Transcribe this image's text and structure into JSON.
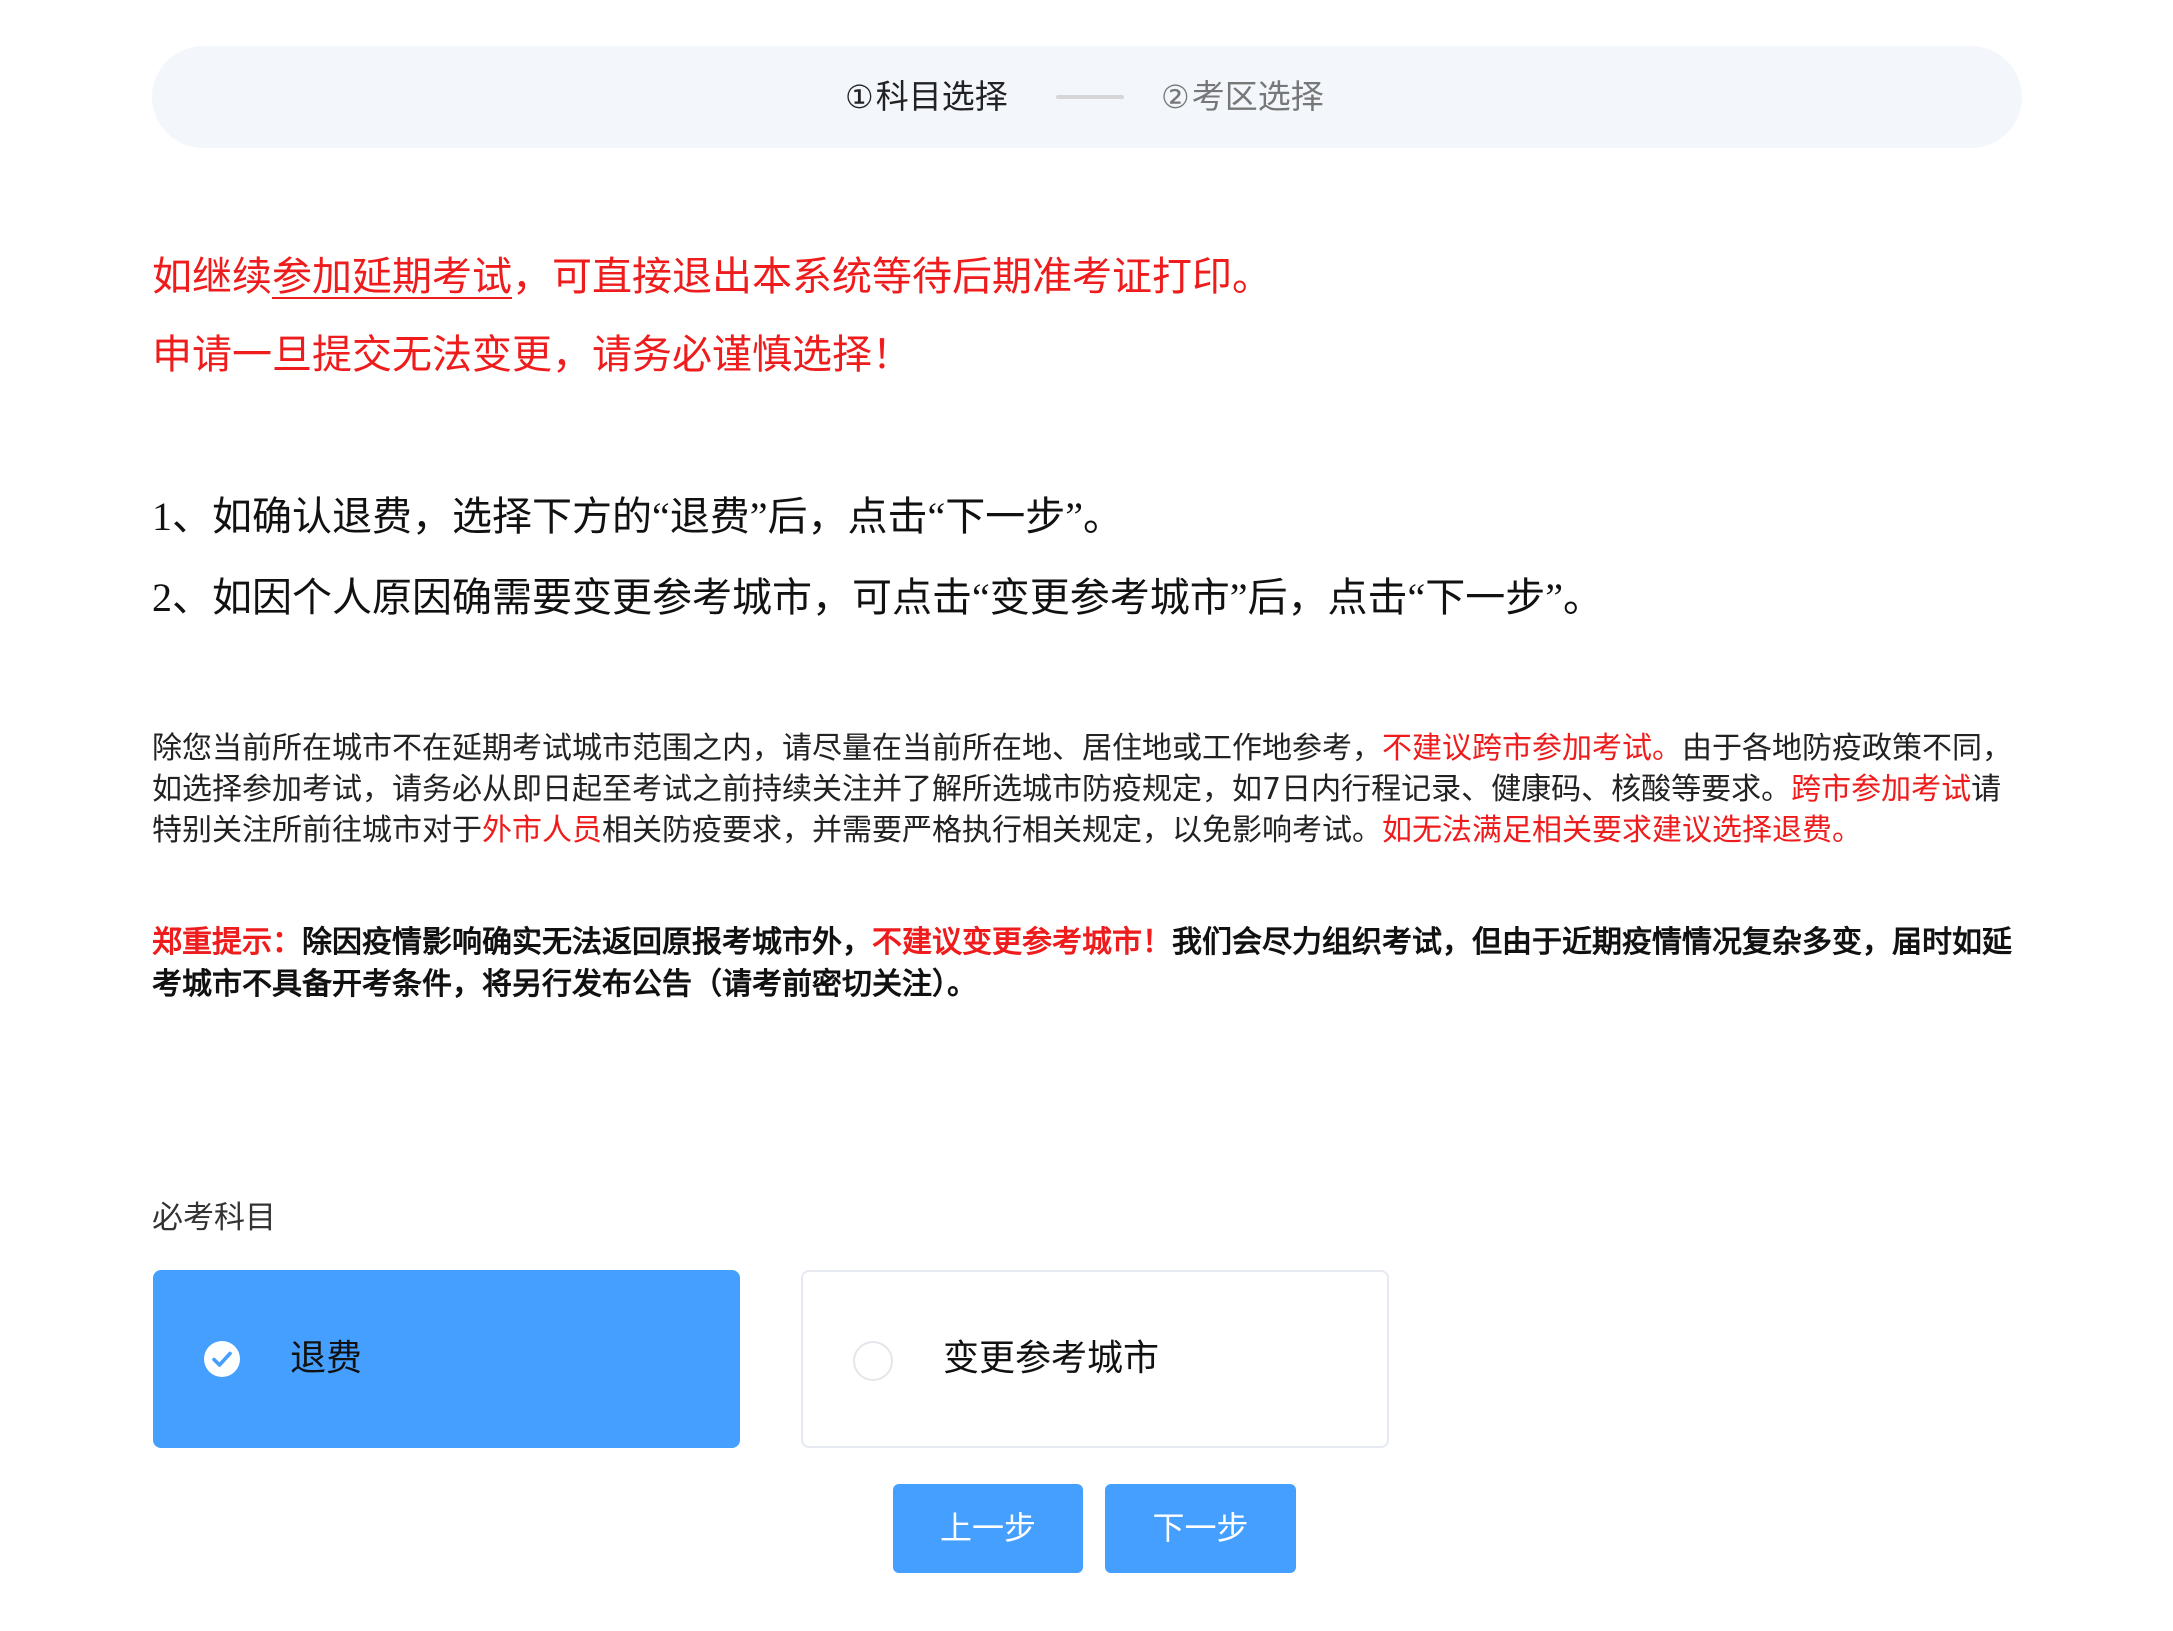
{
  "stepper": {
    "step1_number": "①",
    "step1_label": "科目选择",
    "step2_number": "②",
    "step2_label": "考区选择"
  },
  "notices": {
    "line1_prefix": "如继续",
    "line1_link": "参加延期考试",
    "line1_suffix": "，可直接退出本系统等待后期准考证打印。",
    "line2": "申请一旦提交无法变更，请务必谨慎选择！"
  },
  "instructions": {
    "line1": "1、如确认退费，选择下方的“退费”后，点击“下一步”。",
    "line2": "2、如因个人原因确需要变更参考城市，可点击“变更参考城市”后，点击“下一步”。"
  },
  "paragraph": {
    "part1": "除您当前所在城市不在延期考试城市范围之内，请尽量在当前所在地、居住地或工作地参考，",
    "part2_red": "不建议跨市参加考试。",
    "part3": "由于各地防疫政策不同，如选择参加考试，请务必从即日起至考试之前持续关注并了解所选城市防疫规定，如7日内行程记录、健康码、核酸等要求。",
    "part4_red": "跨市参加考试",
    "part5": "请特别关注所前往城市对于",
    "part6_red": "外市人员",
    "part7": "相关防疫要求，并需要严格执行相关规定，以免影响考试。",
    "part8_red": "如无法满足相关要求建议选择退费。"
  },
  "warning": {
    "label_red": "郑重提示：",
    "part1": "除因疫情影响确实无法返回原报考城市外，",
    "part2_red": "不建议变更参考城市！",
    "part3": "我们会尽力组织考试，但由于近期疫情情况复杂多变，届时如延考城市不具备开考条件，将另行发布公告（请考前密切关注）。"
  },
  "subject_label": "必考科目",
  "options": [
    {
      "label": "退费",
      "selected": true
    },
    {
      "label": "变更参考城市",
      "selected": false
    }
  ],
  "buttons": {
    "prev": "上一步",
    "next": "下一步"
  },
  "colors": {
    "accent": "#449ffe",
    "warning_red": "#ee1c1c",
    "stepper_bg": "#f3f7fc"
  }
}
